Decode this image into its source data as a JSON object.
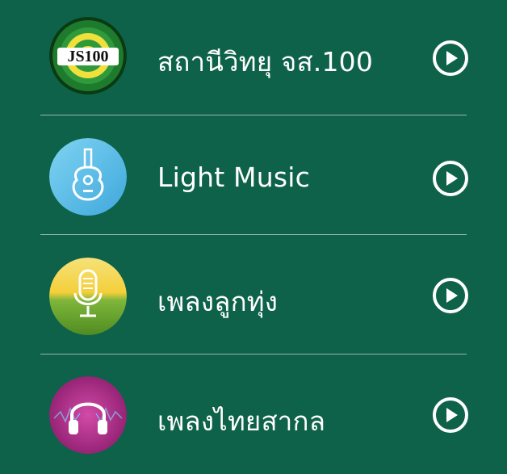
{
  "stations": [
    {
      "name": "สถานีวิทยุ จส.100",
      "logo": "js100-logo",
      "logo_text": "JS100",
      "play_icon": "play-circle-icon"
    },
    {
      "name": "Light Music",
      "logo": "guitar-icon",
      "play_icon": "play-circle-icon"
    },
    {
      "name": "เพลงลูกทุ่ง",
      "logo": "microphone-icon",
      "play_icon": "play-circle-icon"
    },
    {
      "name": "เพลงไทยสากล",
      "logo": "headphones-icon",
      "play_icon": "play-circle-icon"
    }
  ],
  "colors": {
    "background": "#0e6249",
    "text": "#ffffff",
    "divider": "#8fb8a8"
  }
}
